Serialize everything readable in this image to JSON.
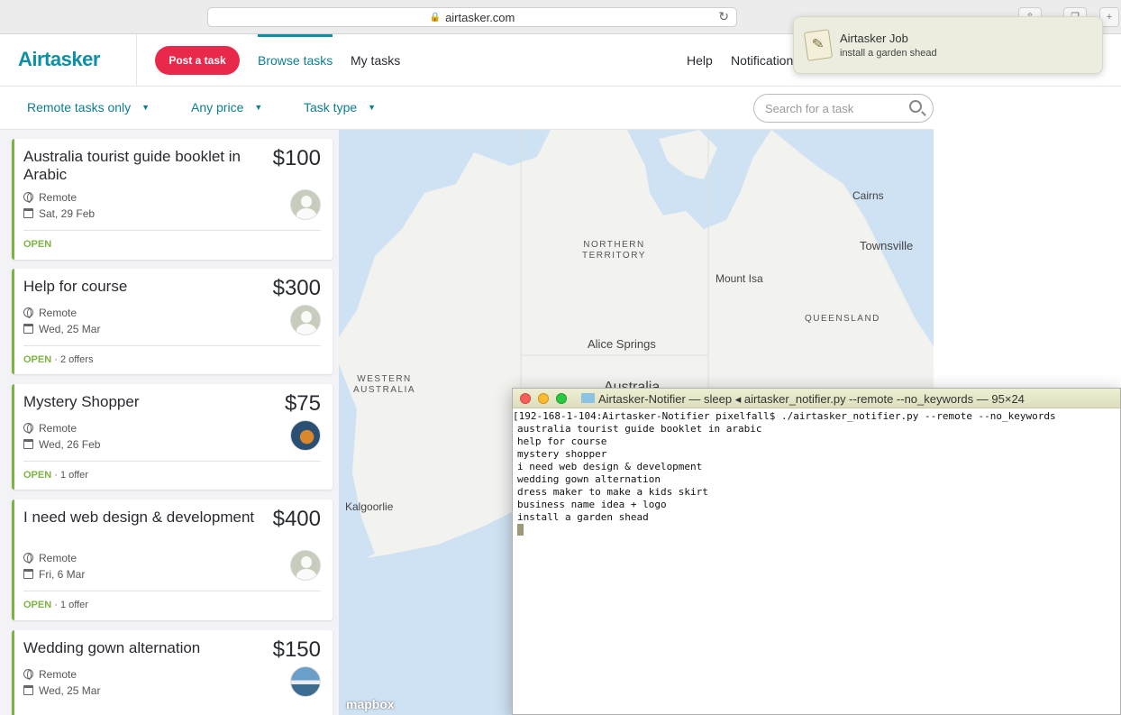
{
  "browser": {
    "url": "airtasker.com"
  },
  "header": {
    "logo": "Airtasker",
    "post_button": "Post a task",
    "nav": {
      "browse": "Browse tasks",
      "my_tasks": "My tasks",
      "help": "Help",
      "notifications": "Notification"
    }
  },
  "notification": {
    "title": "Airtasker Job",
    "body": "install a garden shead"
  },
  "filters": {
    "remote": "Remote tasks only",
    "price": "Any price",
    "type": "Task type",
    "search_placeholder": "Search for a task"
  },
  "tasks": [
    {
      "title": "Australia tourist guide booklet in Arabic",
      "price": "$100",
      "location": "Remote",
      "date": "Sat, 29 Feb",
      "status": "OPEN",
      "offers": ""
    },
    {
      "title": "Help for course",
      "price": "$300",
      "location": "Remote",
      "date": "Wed, 25 Mar",
      "status": "OPEN",
      "offers": " · 2 offers"
    },
    {
      "title": "Mystery Shopper",
      "price": "$75",
      "location": "Remote",
      "date": "Wed, 26 Feb",
      "status": "OPEN",
      "offers": " · 1 offer"
    },
    {
      "title": "I need web design & development",
      "price": "$400",
      "location": "Remote",
      "date": "Fri, 6 Mar",
      "status": "OPEN",
      "offers": " · 1 offer"
    },
    {
      "title": "Wedding gown alternation",
      "price": "$150",
      "location": "Remote",
      "date": "Wed, 25 Mar",
      "status": "",
      "offers": ""
    }
  ],
  "map": {
    "labels": {
      "cairns": "Cairns",
      "townsville": "Townsville",
      "northern_territory_1": "NORTHERN",
      "northern_territory_2": "TERRITORY",
      "mount_isa": "Mount Isa",
      "queensland": "QUEENSLAND",
      "alice_springs": "Alice Springs",
      "western_australia_1": "WESTERN",
      "western_australia_2": "AUSTRALIA",
      "australia": "Australia",
      "kalgoorlie": "Kalgoorlie"
    },
    "attribution": "mapbox"
  },
  "terminal": {
    "title": "Airtasker-Notifier — sleep ◂ airtasker_notifier.py --remote --no_keywords — 95×24",
    "lines": [
      "[192-168-1-104:Airtasker-Notifier pixelfall$ ./airtasker_notifier.py --remote --no_keywords",
      "australia tourist guide booklet in arabic",
      "help for course",
      "mystery shopper",
      "i need web design & development",
      "wedding gown alternation",
      "dress maker to make a kids skirt",
      "business name idea + logo",
      "install a garden shead"
    ]
  },
  "colors": {
    "brand": "#0d8fa6",
    "post_button": "#e8294b",
    "open_status": "#7db343",
    "water": "#cfe2f3"
  }
}
